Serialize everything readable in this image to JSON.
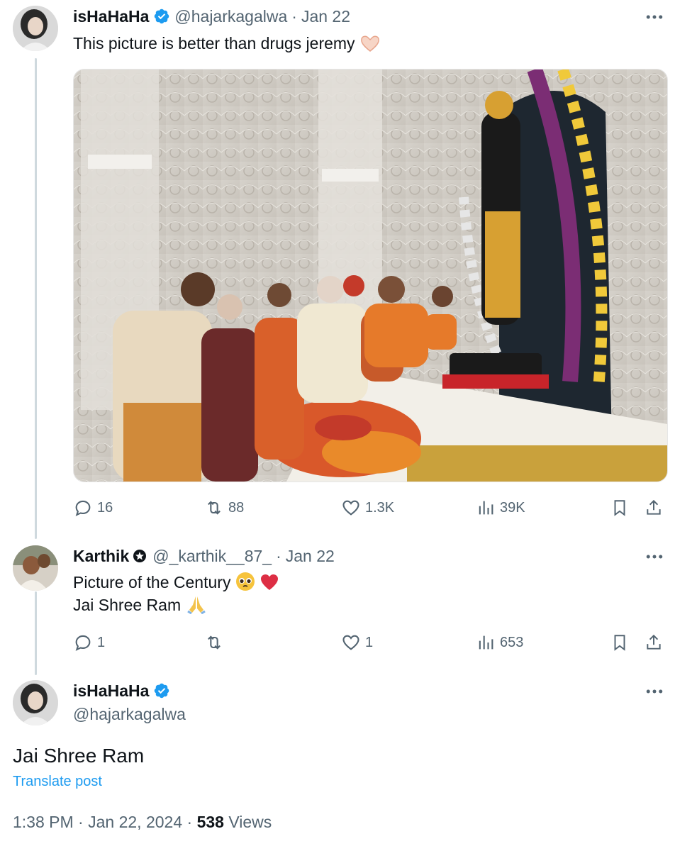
{
  "tweet1": {
    "name": "isHaHaHa",
    "handle": "@hajarkagalwa",
    "sep": "·",
    "date": "Jan 22",
    "text": "This picture is better than drugs jeremy",
    "emoji": "heart-hands",
    "stats": {
      "replies": "16",
      "reposts": "88",
      "likes": "1.3K",
      "views": "39K"
    }
  },
  "tweet2": {
    "name": "Karthik",
    "handle": "@_karthik__87_",
    "sep": "·",
    "date": "Jan 22",
    "line1": "Picture of the Century",
    "line2": "Jai Shree Ram",
    "stats": {
      "replies": "1",
      "reposts": "",
      "likes": "1",
      "views": "653"
    }
  },
  "tweet3": {
    "name": "isHaHaHa",
    "handle": "@hajarkagalwa",
    "text": "Jai Shree Ram",
    "translate": "Translate post",
    "time": "1:38 PM",
    "sep": "·",
    "date": "Jan 22, 2024",
    "sep2": "·",
    "views_count": "538",
    "views_label": "Views"
  },
  "colors": {
    "verified": "#1d9bf0",
    "muted": "#536471",
    "link": "#1d9bf0",
    "thread": "#cfd9de"
  },
  "icons": [
    "reply-icon",
    "repost-icon",
    "like-icon",
    "views-icon",
    "bookmark-icon",
    "share-icon",
    "more-icon",
    "verified-badge-icon"
  ]
}
